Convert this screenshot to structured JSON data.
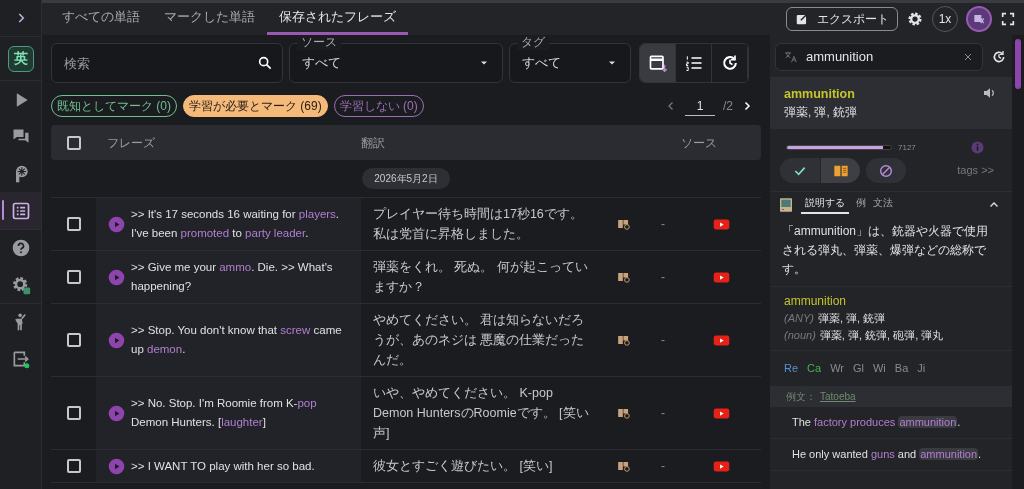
{
  "sidebar": {
    "language": "英",
    "items": [
      {
        "kind": "play",
        "selected": false
      },
      {
        "kind": "chat",
        "selected": false
      },
      {
        "kind": "logo",
        "selected": false
      },
      {
        "kind": "list",
        "selected": true
      },
      {
        "kind": "help",
        "selected": false
      },
      {
        "kind": "settings",
        "selected": false
      },
      {
        "kind": "person",
        "selected": false
      },
      {
        "kind": "exit",
        "selected": false
      }
    ]
  },
  "tabs": [
    {
      "label": "すべての単語",
      "selected": false
    },
    {
      "label": "マークした単語",
      "selected": false
    },
    {
      "label": "保存されたフレーズ",
      "selected": true
    }
  ],
  "filters": {
    "search": {
      "placeholder": "検索"
    },
    "source": {
      "label": "ソース",
      "value": "すべて"
    },
    "tag": {
      "label": "タグ",
      "value": "すべて"
    },
    "views": [
      {
        "kind": "calendar",
        "selected": true
      },
      {
        "kind": "list",
        "selected": false
      },
      {
        "kind": "history",
        "selected": false
      }
    ]
  },
  "chips": [
    {
      "label": "既知としてマーク (0)",
      "color": "#6fbf8f",
      "selected": false
    },
    {
      "label": "学習が必要とマーク (69)",
      "color": "#f5b97a",
      "selected": true
    },
    {
      "label": "学習しない (0)",
      "color": "#9b6fb8",
      "selected": false
    }
  ],
  "pagination": {
    "page": "1",
    "total": "/2"
  },
  "table": {
    "select_all_checked": false,
    "columns": [
      "フレーズ",
      "翻訳",
      "ソース"
    ],
    "date_group": "2026年5月2日",
    "rows": [
      {
        "checked": false,
        "segments": [
          {
            "kind": "plain",
            "text": ">> It's 17 seconds 16 waiting for "
          },
          {
            "kind": "word",
            "text": "players"
          },
          {
            "kind": "plain",
            "text": ". I've been "
          },
          {
            "kind": "word",
            "text": "promoted"
          },
          {
            "kind": "plain",
            "text": " to "
          },
          {
            "kind": "word",
            "text": "party leader"
          },
          {
            "kind": "plain",
            "text": "."
          }
        ],
        "translation": "プレイヤー待ち時間は17秒16です。私は党首に昇格しました。",
        "status": "-"
      },
      {
        "checked": false,
        "segments": [
          {
            "kind": "plain",
            "text": ">> Give me your "
          },
          {
            "kind": "word",
            "text": "ammo"
          },
          {
            "kind": "plain",
            "text": ". Die. >> What's happening?"
          }
        ],
        "translation": "弾薬をくれ。 死ぬ。 何が起こっていますか？",
        "status": "-"
      },
      {
        "checked": false,
        "segments": [
          {
            "kind": "plain",
            "text": ">> Stop. You don't know that "
          },
          {
            "kind": "word",
            "text": "screw"
          },
          {
            "kind": "plain",
            "text": " came up "
          },
          {
            "kind": "word",
            "text": "demon"
          },
          {
            "kind": "plain",
            "text": "."
          }
        ],
        "translation": "やめてください。 君は知らないだろうが、あのネジは 悪魔の仕業だったんだ。",
        "status": "-"
      },
      {
        "checked": false,
        "segments": [
          {
            "kind": "plain",
            "text": ">> No. Stop. I'm Roomie from K-"
          },
          {
            "kind": "word",
            "text": "pop"
          },
          {
            "kind": "plain",
            "text": " Demon Hunters. ["
          },
          {
            "kind": "word",
            "text": "laughter"
          },
          {
            "kind": "plain",
            "text": "]"
          }
        ],
        "translation": "いや、やめてください。 K-pop Demon HuntersのRoomieです。 [笑い声]",
        "status": "-"
      },
      {
        "checked": false,
        "segments": [
          {
            "kind": "plain",
            "text": ">> I WANT TO play with her so bad."
          }
        ],
        "translation": "彼女とすごく遊びたい。 [笑い]",
        "status": "-"
      }
    ]
  },
  "toolbar": {
    "export": "エクスポート",
    "speed": "1x"
  },
  "lookup": {
    "query": "ammunition",
    "word": "ammunition",
    "meanings": "弾薬, 弾, 銃弾",
    "frequency": {
      "level": 0.92,
      "reading": "7127"
    },
    "status_buttons": [
      {
        "kind": "known",
        "selected": false
      },
      {
        "kind": "learning",
        "selected": true
      },
      {
        "kind": "ignore",
        "selected": false
      }
    ],
    "tags_link": "tags >>",
    "tabs": [
      {
        "label": "説明する",
        "selected": true
      },
      {
        "label": "例",
        "selected": false
      },
      {
        "label": "文法",
        "selected": false
      }
    ],
    "explanation": "「ammunition」は、銃器や火器で使用される弾丸、弾薬、爆弾などの総称です。",
    "dictionary": {
      "headword": "ammunition",
      "senses": [
        {
          "pos": "(ANY)",
          "text": "弾薬, 弾, 銃弾"
        },
        {
          "pos": "(noun)",
          "text": "弾薬, 弾, 銃弾, 砲弾, 弾丸"
        }
      ]
    },
    "dictionary_links": [
      {
        "label": "Re",
        "color": "#5b8fd0"
      },
      {
        "label": "Ca",
        "color": "#4caf50"
      },
      {
        "label": "Wr",
        "color": "#8a8b8f"
      },
      {
        "label": "Gl",
        "color": "#8a8b8f"
      },
      {
        "label": "Wi",
        "color": "#8a8b8f"
      },
      {
        "label": "Ba",
        "color": "#8a8b8f"
      },
      {
        "label": "Ji",
        "color": "#8a8b8f"
      }
    ],
    "examples_header": {
      "label": "例文：",
      "source": "Tatoeba"
    },
    "examples": [
      {
        "segments": [
          {
            "kind": "plain",
            "text": "The "
          },
          {
            "kind": "word",
            "text": "factory produces "
          },
          {
            "kind": "target",
            "text": "ammunition"
          },
          {
            "kind": "plain",
            "text": "."
          }
        ]
      },
      {
        "segments": [
          {
            "kind": "plain",
            "text": "He only wanted "
          },
          {
            "kind": "word",
            "text": "guns"
          },
          {
            "kind": "plain",
            "text": " and "
          },
          {
            "kind": "target",
            "text": "ammunition"
          },
          {
            "kind": "plain",
            "text": "."
          }
        ]
      }
    ]
  }
}
